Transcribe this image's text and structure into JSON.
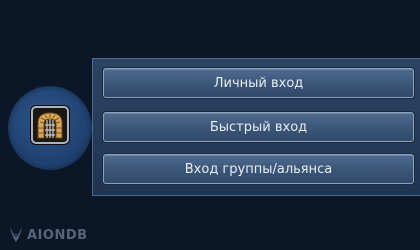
{
  "menu": {
    "items": [
      {
        "label": "Личный вход"
      },
      {
        "label": "Быстрый вход"
      },
      {
        "label": "Вход группы/альянса"
      }
    ]
  },
  "icon": {
    "name": "dungeon-gate-icon"
  },
  "watermark": {
    "text": "AIONDB",
    "icon": "aion-wing-logo"
  },
  "colors": {
    "background": "#0b1726",
    "panel": "#2c4463",
    "button": "#4f6b8f",
    "circle": "#1e3f6e",
    "text": "#e6edf6"
  }
}
